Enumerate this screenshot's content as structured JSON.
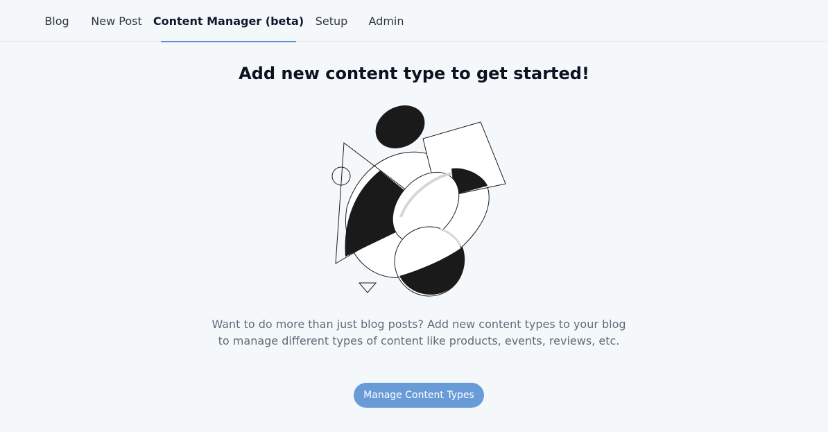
{
  "nav": {
    "tabs": [
      {
        "label": "Blog"
      },
      {
        "label": "New Post"
      },
      {
        "label": "Content Manager (beta)",
        "active": true
      },
      {
        "label": "Setup"
      },
      {
        "label": "Admin"
      }
    ]
  },
  "main": {
    "title": "Add new content type to get started!",
    "description_line1": "Want to do more than just blog posts? Add new content types to your blog",
    "description_line2": "to manage different types of content like products, events, reviews, etc.",
    "button_label": "Manage Content Types",
    "illustration_icon": "abstract-shapes-illustration"
  },
  "colors": {
    "accent": "#6a9bd9",
    "background": "#f5f8fb",
    "shape_fill": "#1a1a1a"
  }
}
